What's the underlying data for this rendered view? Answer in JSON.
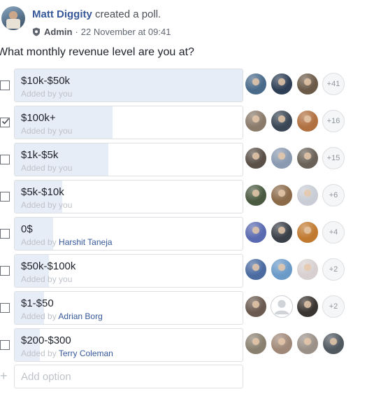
{
  "post": {
    "author": "Matt Diggity",
    "action": "created a poll.",
    "role": "Admin",
    "separator": "·",
    "timestamp": "22 November at 09:41",
    "question": "What monthly revenue level are you at?"
  },
  "poll": {
    "options": [
      {
        "label": "$10k-$50k",
        "added_prefix": "Added by ",
        "added_by": "you",
        "added_by_is_link": false,
        "checked": false,
        "vote_fill": 1.0,
        "more": "+41",
        "voters": [
          {
            "icon": "avatar-photo",
            "color": "#4a6a8a"
          },
          {
            "icon": "avatar-photo",
            "color": "#2e3f55"
          },
          {
            "icon": "avatar-photo",
            "color": "#6b5a48"
          }
        ]
      },
      {
        "label": "$100k+",
        "added_prefix": "Added by ",
        "added_by": "you",
        "added_by_is_link": false,
        "checked": true,
        "vote_fill": 0.43,
        "more": "+16",
        "voters": [
          {
            "icon": "avatar-photo",
            "color": "#8a7a6a"
          },
          {
            "icon": "avatar-photo",
            "color": "#3a4654"
          },
          {
            "icon": "avatar-photo",
            "color": "#b07040"
          }
        ]
      },
      {
        "label": "$1k-$5k",
        "added_prefix": "Added by ",
        "added_by": "you",
        "added_by_is_link": false,
        "checked": false,
        "vote_fill": 0.41,
        "more": "+15",
        "voters": [
          {
            "icon": "avatar-photo",
            "color": "#5a5048"
          },
          {
            "icon": "avatar-photo",
            "color": "#8a9ab0"
          },
          {
            "icon": "avatar-photo",
            "color": "#6a6258"
          }
        ]
      },
      {
        "label": "$5k-$10k",
        "added_prefix": "Added by ",
        "added_by": "you",
        "added_by_is_link": false,
        "checked": false,
        "vote_fill": 0.21,
        "more": "+6",
        "voters": [
          {
            "icon": "avatar-photo",
            "color": "#4a5a40"
          },
          {
            "icon": "avatar-photo",
            "color": "#8a6a48"
          },
          {
            "icon": "avatar-photo",
            "color": "#c8ccd4"
          }
        ]
      },
      {
        "label": "0$",
        "added_prefix": "Added by ",
        "added_by": "Harshit Taneja",
        "added_by_is_link": true,
        "checked": false,
        "vote_fill": 0.17,
        "more": "+4",
        "voters": [
          {
            "icon": "avatar-photo",
            "color": "#5a6ab0"
          },
          {
            "icon": "avatar-photo",
            "color": "#3a4048"
          },
          {
            "icon": "avatar-photo",
            "color": "#c07a30"
          }
        ]
      },
      {
        "label": "$50k-$100k",
        "added_prefix": "Added by ",
        "added_by": "you",
        "added_by_is_link": false,
        "checked": false,
        "vote_fill": 0.15,
        "more": "+2",
        "voters": [
          {
            "icon": "avatar-photo",
            "color": "#4a6aa0"
          },
          {
            "icon": "avatar-photo",
            "color": "#6a9ac8"
          },
          {
            "icon": "avatar-photo",
            "color": "#d8d0d0"
          }
        ]
      },
      {
        "label": "$1-$50",
        "added_prefix": "Added by ",
        "added_by": "Adrian Borg",
        "added_by_is_link": true,
        "checked": false,
        "vote_fill": 0.13,
        "more": "+2",
        "voters": [
          {
            "icon": "avatar-photo",
            "color": "#6a5a50"
          },
          {
            "icon": "default-avatar",
            "color": "#d0d3d8"
          },
          {
            "icon": "avatar-photo",
            "color": "#3a3430"
          }
        ]
      },
      {
        "label": "$200-$300",
        "added_prefix": "Added by ",
        "added_by": "Terry Coleman",
        "added_by_is_link": true,
        "checked": false,
        "vote_fill": 0.11,
        "more": "",
        "voters": [
          {
            "icon": "avatar-photo",
            "color": "#8a8070"
          },
          {
            "icon": "avatar-photo",
            "color": "#a08878"
          },
          {
            "icon": "avatar-photo",
            "color": "#9a9088"
          },
          {
            "icon": "avatar-photo",
            "color": "#505860"
          }
        ]
      }
    ],
    "add_option": {
      "plus": "+",
      "placeholder": "Add option"
    }
  },
  "colors": {
    "link": "#365899",
    "fill": "#e7edf7",
    "border": "#dddfe2",
    "muted": "#bec3c9"
  }
}
